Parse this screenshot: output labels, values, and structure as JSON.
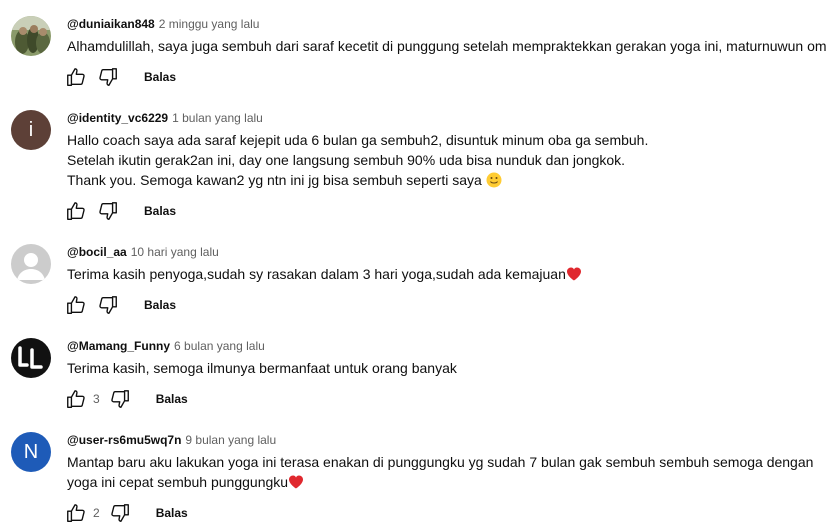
{
  "comments": [
    {
      "author": "@duniaikan848",
      "time": "2 minggu yang lalu",
      "lines": [
        "Alhamdulillah, saya juga sembuh dari saraf kecetit di punggung setelah mempraktekkan gerakan yoga ini, maturnuwun om"
      ],
      "likes": "",
      "reply_label": "Balas",
      "avatar": {
        "type": "photo",
        "color": "#6b7a4a"
      }
    },
    {
      "author": "@identity_vc6229",
      "time": "1 bulan yang lalu",
      "lines": [
        "Hallo coach saya ada saraf kejepit uda 6 bulan ga sembuh2, disuntuk minum oba ga sembuh.",
        "Setelah ikutin gerak2an ini, day one langsung sembuh 90% uda bisa nunduk dan jongkok.",
        "Thank you. Semoga kawan2 yg ntn ini jg bisa sembuh seperti saya"
      ],
      "likes": "",
      "reply_label": "Balas",
      "avatar": {
        "type": "letter",
        "letter": "i",
        "color": "#5d4037"
      }
    },
    {
      "author": "@bocil_aa",
      "time": "10 hari yang lalu",
      "lines": [
        "Terima kasih penyoga,sudah sy rasakan dalam 3 hari yoga,sudah ada kemajuan"
      ],
      "likes": "",
      "reply_label": "Balas",
      "avatar": {
        "type": "default",
        "color": "#cccccc"
      }
    },
    {
      "author": "@Mamang_Funny",
      "time": "6 bulan yang lalu",
      "lines": [
        "Terima kasih, semoga ilmunya bermanfaat untuk orang banyak"
      ],
      "likes": "3",
      "reply_label": "Balas",
      "avatar": {
        "type": "logo",
        "letter": "LL",
        "color": "#111111"
      }
    },
    {
      "author": "@user-rs6mu5wq7n",
      "time": "9 bulan yang lalu",
      "lines": [
        "Mantap baru aku lakukan yoga ini terasa enakan di punggungku yg sudah 7 bulan gak sembuh sembuh semoga dengan",
        "yoga ini cepat sembuh punggungku"
      ],
      "likes": "2",
      "reply_label": "Balas",
      "avatar": {
        "type": "letter",
        "letter": "N",
        "color": "#1e5bb8"
      }
    }
  ]
}
